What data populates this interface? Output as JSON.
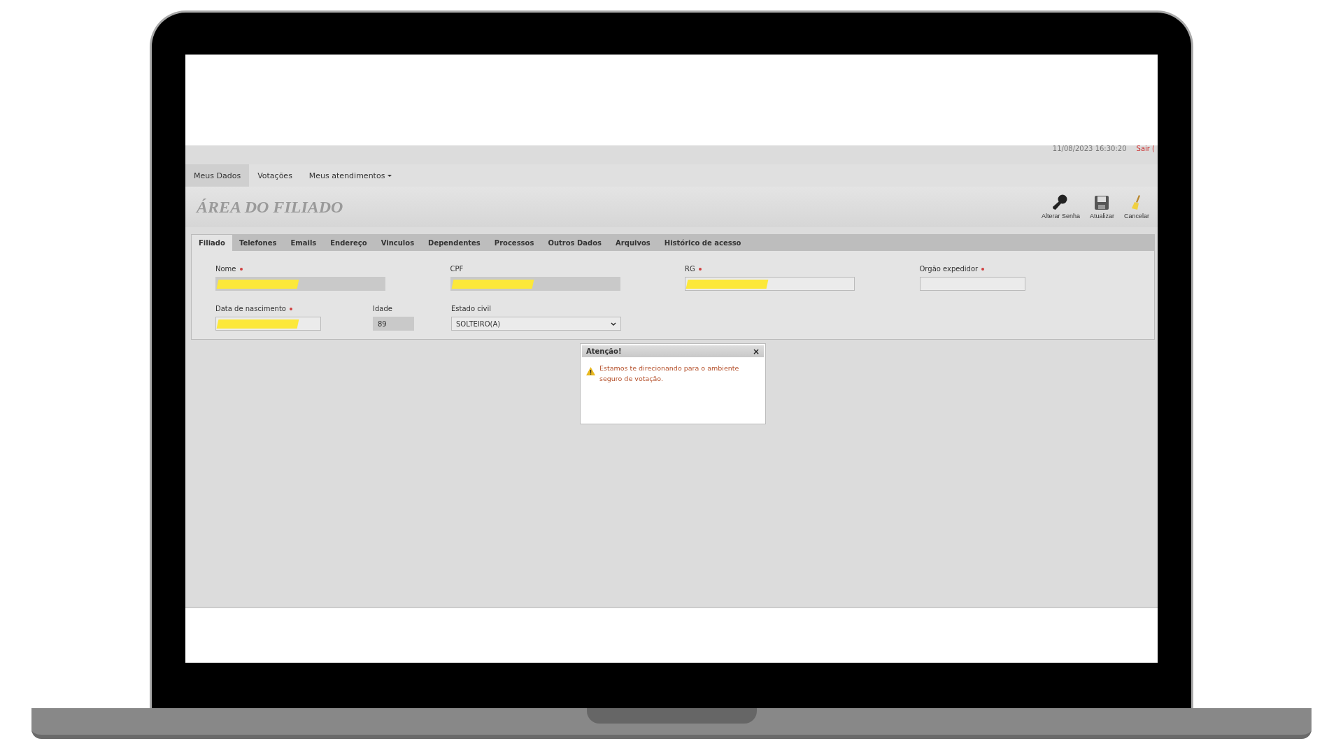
{
  "header": {
    "last_activity": "11/08/2023 16:30:20",
    "logout": "Sair ("
  },
  "nav": [
    {
      "label": "Meus Dados",
      "selected": true,
      "dropdown": false
    },
    {
      "label": "Votações",
      "selected": false,
      "dropdown": false
    },
    {
      "label": "Meus atendimentos",
      "selected": false,
      "dropdown": true
    }
  ],
  "page_title": "ÁREA DO FILIADO",
  "toolbar": [
    {
      "label": "Alterar Senha",
      "kind": "key"
    },
    {
      "label": "Atualizar",
      "kind": "save"
    },
    {
      "label": "Cancelar",
      "kind": "broom"
    }
  ],
  "tabs": [
    {
      "label": "Filiado",
      "selected": true
    },
    {
      "label": "Telefones",
      "selected": false
    },
    {
      "label": "Emails",
      "selected": false
    },
    {
      "label": "Endereço",
      "selected": false
    },
    {
      "label": "Vinculos",
      "selected": false
    },
    {
      "label": "Dependentes",
      "selected": false
    },
    {
      "label": "Processos",
      "selected": false
    },
    {
      "label": "Outros Dados",
      "selected": false
    },
    {
      "label": "Arquivos",
      "selected": false
    },
    {
      "label": "Histórico de acesso",
      "selected": false
    }
  ],
  "rows": [
    [
      {
        "label": "Nome",
        "required": true,
        "kind": "text",
        "redacted": true,
        "disabled": true
      },
      {
        "label": "CPF",
        "required": false,
        "kind": "text",
        "redacted": true,
        "disabled": true
      },
      {
        "label": "RG",
        "required": true,
        "kind": "text",
        "redacted": true,
        "disabled": false
      },
      {
        "label": "Orgão expedidor",
        "required": true,
        "kind": "text",
        "redacted": false,
        "disabled": false
      }
    ],
    [
      {
        "label": "Data de nascimento",
        "required": true,
        "kind": "text",
        "redacted": true,
        "disabled": false
      },
      {
        "label": "Idade",
        "required": false,
        "kind": "text",
        "value": "89",
        "redacted": false,
        "disabled": true
      },
      {
        "label": "Estado civil",
        "required": false,
        "kind": "select",
        "value": "SOLTEIRO(A)",
        "disabled": false
      }
    ]
  ],
  "dialog": {
    "title": "Atenção!",
    "close": "×",
    "message": "Estamos te direcionando para o ambiente seguro de votação."
  }
}
